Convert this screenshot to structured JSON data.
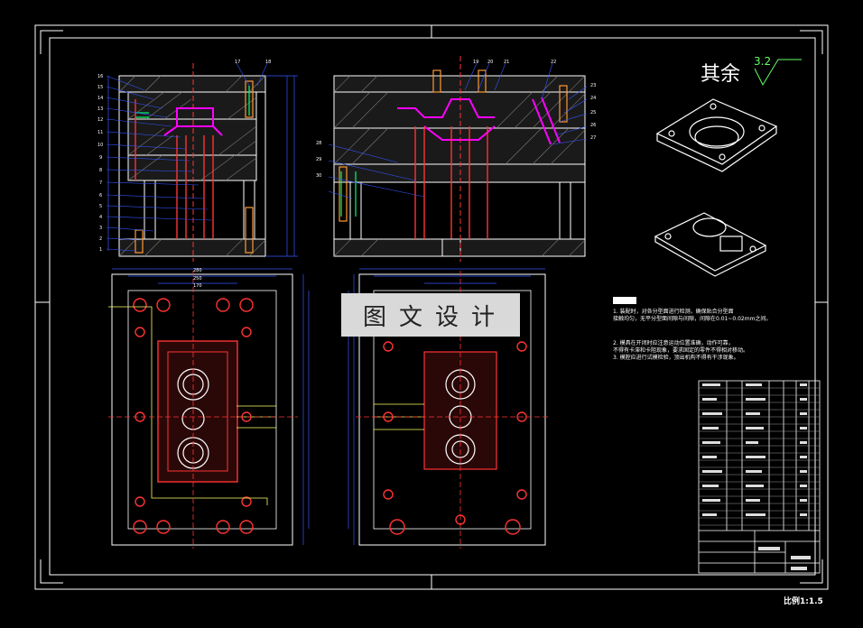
{
  "watermark": "图文设计",
  "roughness": {
    "label": "其余",
    "value": "3.2"
  },
  "scale_note": "比例1:1.5",
  "tech_notes": [
    "1. 装配时，对各分型面进行检测，确保贴合分型面",
    "接触均匀，无平分型面间隙与间隙，间隙在0.01~0.02mm之间。",
    "2. 模具在开闭时应注意运动位置准确，动作可靠，",
    "不得有卡滞和卡阻现象，要求固定的零件不得相对移动。",
    "3. 模腔应进行试模检验，顶出机构不得有干涉现象。"
  ],
  "callouts_left": [
    "16",
    "15",
    "14",
    "13",
    "12",
    "11",
    "10",
    "9",
    "8",
    "7",
    "6",
    "5",
    "4",
    "3",
    "2",
    "1"
  ],
  "callouts_top": [
    "17",
    "18",
    "19",
    "20",
    "21",
    "22",
    "23",
    "24",
    "25",
    "26",
    "27",
    "28",
    "29",
    "30"
  ],
  "dims": [
    "280",
    "250",
    "170"
  ]
}
